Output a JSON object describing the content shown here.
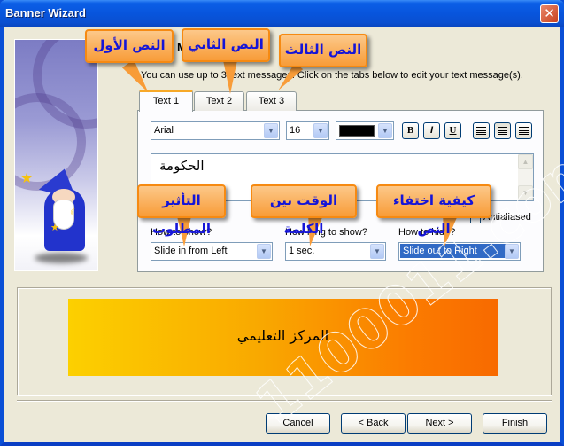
{
  "window": {
    "title": "Banner Wizard",
    "close_glyph": "✕"
  },
  "header": {
    "title": "Messages",
    "description": "You can use up to 3 text messages. Click on the tabs below to edit your text message(s)."
  },
  "tabs": [
    {
      "label": "Text 1",
      "active": true
    },
    {
      "label": "Text 2",
      "active": false
    },
    {
      "label": "Text 3",
      "active": false
    }
  ],
  "format": {
    "font": "Arial",
    "size": "16",
    "color": "#000000",
    "bold_glyph": "B",
    "italic_glyph": "I",
    "underline_glyph": "U",
    "arrow_glyph": "▼"
  },
  "message_text": "الحكومة",
  "antialiased": {
    "label": "Antialiased",
    "checked": false
  },
  "fields": {
    "show": {
      "label": "How to show?",
      "value": "Slide in from Left"
    },
    "duration": {
      "label": "How long to show?",
      "value": "1 sec."
    },
    "hide": {
      "label": "How to hide?",
      "value": "Slide out to Right"
    }
  },
  "preview": {
    "text": "المركز التعليمي",
    "gradient_start": "#fcd000",
    "gradient_end": "#f86a00"
  },
  "buttons": {
    "cancel": "Cancel",
    "back": "< Back",
    "next": "Next >",
    "finish": "Finish"
  },
  "callouts": {
    "text1": "النص الأول",
    "text2": "النص الثاني",
    "text3": "النص الثالث",
    "effect": "التأثير المطلوب",
    "duration": "الوقت بين الكلمة",
    "hide": "كيفية اختفاء النص"
  },
  "watermark": "1100011.com"
}
